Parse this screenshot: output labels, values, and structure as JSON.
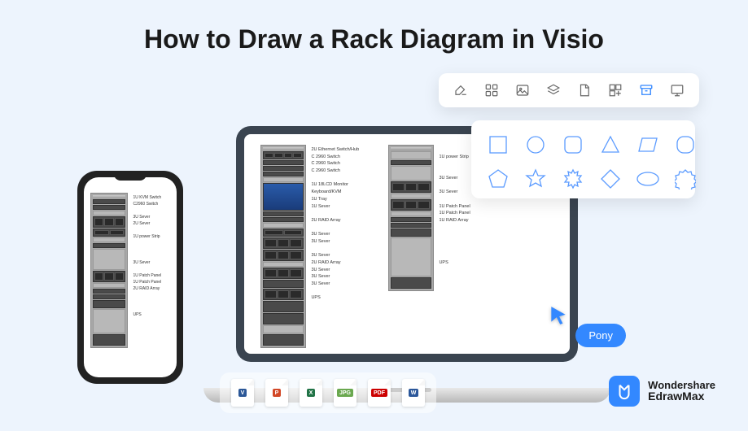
{
  "title": "How to Draw a Rack Diagram in Visio",
  "toolbar": {
    "items": [
      "fill-icon",
      "grid-icon",
      "image-icon",
      "layers-icon",
      "page-icon",
      "components-icon",
      "archive-icon",
      "present-icon"
    ],
    "active_index": 6
  },
  "shapes": [
    "square",
    "circle",
    "rounded-square",
    "triangle",
    "parallelogram",
    "rounded-rect",
    "pentagon",
    "star",
    "burst",
    "diamond",
    "oval",
    "seal"
  ],
  "cursor_label": "Pony",
  "file_formats": [
    {
      "label": "V",
      "color": "#2b5797"
    },
    {
      "label": "P",
      "color": "#d24726"
    },
    {
      "label": "X",
      "color": "#217346"
    },
    {
      "label": "JPG",
      "color": "#6aa84f"
    },
    {
      "label": "PDF",
      "color": "#cc0000"
    },
    {
      "label": "W",
      "color": "#2b579a"
    }
  ],
  "brand": {
    "line1": "Wondershare",
    "line2": "EdrawMax"
  },
  "rack_labels_laptop_left": [
    "2U Ethernet Switch/Hub",
    "C 2960 Switch",
    "C 2960 Switch",
    "C 2960 Switch",
    "",
    "1U 18LCD Monitor",
    "Keyboard/KVM",
    "1U Tray",
    "1U Sever",
    "",
    "2U RAID Array",
    "",
    "3U Sever",
    "3U Sever",
    "",
    "3U Sever",
    "2U RAID Array",
    "3U Sever",
    "3U Sever",
    "3U Sever",
    "",
    "UPS"
  ],
  "rack_labels_laptop_right": [
    "",
    "1U power Strip",
    "",
    "",
    "3U Sever",
    "",
    "3U Sever",
    "",
    "1U Patch Panel",
    "1U Patch Panel",
    "1U RAID Array",
    "",
    "",
    "",
    "",
    "",
    "UPS"
  ],
  "rack_labels_phone": [
    "1U KVM Switch",
    "C2960 Switch",
    "",
    "3U Sever",
    "2U Sever",
    "",
    "1U power Strip",
    "",
    "",
    "",
    "3U Sever",
    "",
    "1U Patch Panel",
    "1U Patch Panel",
    "2U RAID Array",
    "",
    "",
    "",
    "UPS"
  ]
}
